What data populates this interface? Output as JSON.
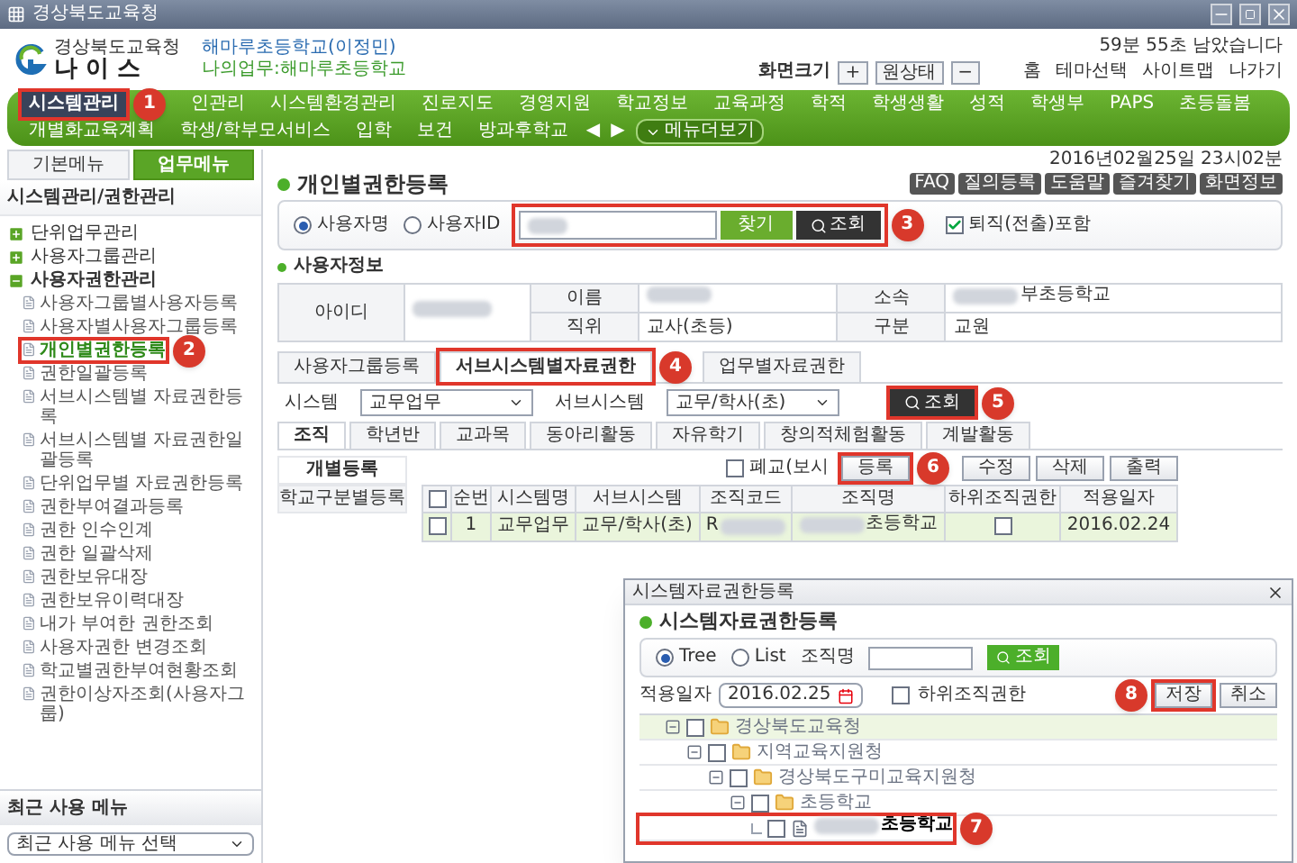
{
  "window": {
    "title": "경상북도교육청"
  },
  "header": {
    "org": "경상북도교육청",
    "logo": "나 이 스",
    "user": "해마루초등학교(이정민)",
    "duty": "나의업무:해마루초등학교",
    "session": "59분 55초 남았습니다",
    "zoom_label": "화면크기",
    "zoom_buttons": [
      "+",
      "원상태",
      "−"
    ],
    "links": [
      "홈",
      "테마선택",
      "사이트맵",
      "나가기"
    ]
  },
  "nav": {
    "items": [
      {
        "label": "시스템관리",
        "selected": true,
        "callout": "1"
      },
      {
        "label": "인관리",
        "selected": false
      },
      {
        "label": "시스템환경관리",
        "selected": false
      },
      {
        "label": "진로지도",
        "selected": false
      },
      {
        "label": "경영지원",
        "selected": false
      },
      {
        "label": "학교정보",
        "selected": false
      },
      {
        "label": "교육과정",
        "selected": false
      },
      {
        "label": "학적",
        "selected": false
      },
      {
        "label": "학생생활",
        "selected": false
      },
      {
        "label": "성적",
        "selected": false
      },
      {
        "label": "학생부",
        "selected": false
      },
      {
        "label": "PAPS",
        "selected": false
      },
      {
        "label": "초등돌봄",
        "selected": false
      },
      {
        "label": "개별화교육계획",
        "selected": false
      },
      {
        "label": "학생/학부모서비스",
        "selected": false
      },
      {
        "label": "입학",
        "selected": false
      },
      {
        "label": "보건",
        "selected": false
      },
      {
        "label": "방과후학교",
        "selected": false
      }
    ],
    "prev": "◀",
    "next": "▶",
    "more": "메뉴더보기"
  },
  "sidebar": {
    "tabs": [
      {
        "label": "기본메뉴",
        "selected": false
      },
      {
        "label": "업무메뉴",
        "selected": true
      }
    ],
    "title": "시스템관리/권한관리",
    "items": [
      {
        "label": "단위업무관리",
        "expanded": false
      },
      {
        "label": "사용자그룹관리",
        "expanded": false
      },
      {
        "label": "사용자권한관리",
        "expanded": true,
        "children": [
          {
            "label": "사용자그룹별사용자등록",
            "selected": false
          },
          {
            "label": "사용자별사용자그룹등록",
            "selected": false
          },
          {
            "label": "개인별권한등록",
            "selected": true,
            "callout": "2"
          },
          {
            "label": "권한일괄등록",
            "selected": false
          },
          {
            "label": "서브시스템별 자료권한등록",
            "selected": false
          },
          {
            "label": "서브시스템별 자료권한일괄등록",
            "selected": false
          },
          {
            "label": "단위업무별 자료권한등록",
            "selected": false
          },
          {
            "label": "권한부여결과등록",
            "selected": false
          },
          {
            "label": "권한 인수인계",
            "selected": false
          },
          {
            "label": "권한 일괄삭제",
            "selected": false
          },
          {
            "label": "권한보유대장",
            "selected": false
          },
          {
            "label": "권한보유이력대장",
            "selected": false
          },
          {
            "label": "내가 부여한 권한조회",
            "selected": false
          },
          {
            "label": "사용자권한 변경조회",
            "selected": false
          },
          {
            "label": "학교별권한부여현황조회",
            "selected": false
          },
          {
            "label": "권한이상자조회(사용자그룹)",
            "selected": false
          }
        ]
      }
    ],
    "recent_title": "최근 사용 메뉴",
    "recent_select": "최근 사용 메뉴 선택"
  },
  "page": {
    "title": "개인별권한등록",
    "datetime": "2016년02월25일 23시02분",
    "tools": [
      "FAQ",
      "질의등록",
      "도움말",
      "즐겨찾기",
      "화면정보"
    ],
    "search": {
      "modes": [
        {
          "label": "사용자명",
          "selected": true
        },
        {
          "label": "사용자ID",
          "selected": false
        }
      ],
      "find": "찾기",
      "query": "조회",
      "callout": "3",
      "retired": {
        "label": "퇴직(전출)포함",
        "checked": true
      }
    },
    "user_info": {
      "title": "사용자정보",
      "id_label": "아이디",
      "fields": [
        {
          "label": "이름",
          "redacted": true
        },
        {
          "label": "소속",
          "value": "부초등학교",
          "redacted_before": true
        },
        {
          "label": "직위",
          "value": "교사(초등)"
        },
        {
          "label": "구분",
          "value": "교원"
        }
      ]
    },
    "tabs": [
      {
        "label": "사용자그룹등록",
        "selected": false
      },
      {
        "label": "서브시스템별자료권한",
        "selected": true,
        "callout": "4"
      },
      {
        "label": "업무별자료권한",
        "selected": false
      }
    ],
    "filters": [
      {
        "label": "시스템",
        "value": "교무업무"
      },
      {
        "label": "서브시스템",
        "value": "교무/학사(초)"
      }
    ],
    "filter_button": {
      "label": "조회",
      "callout": "5"
    },
    "subtabs": [
      {
        "label": "조직",
        "selected": true
      },
      {
        "label": "학년반",
        "selected": false
      },
      {
        "label": "교과목",
        "selected": false
      },
      {
        "label": "동아리활동",
        "selected": false
      },
      {
        "label": "자유학기",
        "selected": false
      },
      {
        "label": "창의적체험활동",
        "selected": false
      },
      {
        "label": "계발활동",
        "selected": false
      }
    ],
    "side_tabs": [
      {
        "label": "개별등록",
        "selected": true
      },
      {
        "label": "학교구분별등록",
        "selected": false
      }
    ],
    "closed_school": {
      "label": "폐교(보시",
      "checked": false
    },
    "actions": [
      {
        "label": "등록",
        "callout": "6"
      },
      {
        "label": "수정"
      },
      {
        "label": "삭제"
      },
      {
        "label": "출력"
      }
    ],
    "table": {
      "header_checked": false,
      "columns": [
        "순번",
        "시스템명",
        "서브시스템",
        "조직코드",
        "조직명",
        "하위조직권한",
        "적용일자"
      ],
      "rows": [
        {
          "selected": true,
          "checked": false,
          "cells": [
            {
              "kind": "text",
              "text": "1"
            },
            {
              "kind": "text",
              "text": "교무업무"
            },
            {
              "kind": "text",
              "text": "교무/학사(초)"
            },
            {
              "kind": "text",
              "text": "R",
              "redacted_after": true
            },
            {
              "kind": "text",
              "text": "초등학교",
              "redacted_before": true
            },
            {
              "kind": "check",
              "checked": false
            },
            {
              "kind": "text",
              "text": "2016.02.24"
            }
          ]
        }
      ]
    }
  },
  "dialog": {
    "title": "시스템자료권한등록",
    "heading": "시스템자료권한등록",
    "modes": [
      {
        "label": "Tree",
        "selected": true
      },
      {
        "label": "List",
        "selected": false
      }
    ],
    "org_label": "조직명",
    "search_button": "조회",
    "date_label": "적용일자",
    "date": "2016.02.25",
    "sub_org": {
      "label": "하위조직권한",
      "checked": false
    },
    "buttons": [
      {
        "label": "저장",
        "callout": "8"
      },
      {
        "label": "취소"
      }
    ],
    "tree": [
      {
        "kind": "folder",
        "label": "경상북도교육청",
        "checked": false,
        "selected": true,
        "children": [
          {
            "kind": "folder",
            "label": "지역교육지원청",
            "checked": false,
            "selected": false,
            "children": [
              {
                "kind": "folder",
                "label": "경상북도구미교육지원청",
                "checked": false,
                "selected": false,
                "children": [
                  {
                    "kind": "folder",
                    "label": "초등학교",
                    "checked": false,
                    "selected": false,
                    "children": [
                      {
                        "kind": "leaf",
                        "label": "초등학교",
                        "redacted_before": true,
                        "checked": false,
                        "selected": false,
                        "callout": "7"
                      }
                    ]
                  }
                ]
              }
            ]
          }
        ]
      }
    ]
  }
}
